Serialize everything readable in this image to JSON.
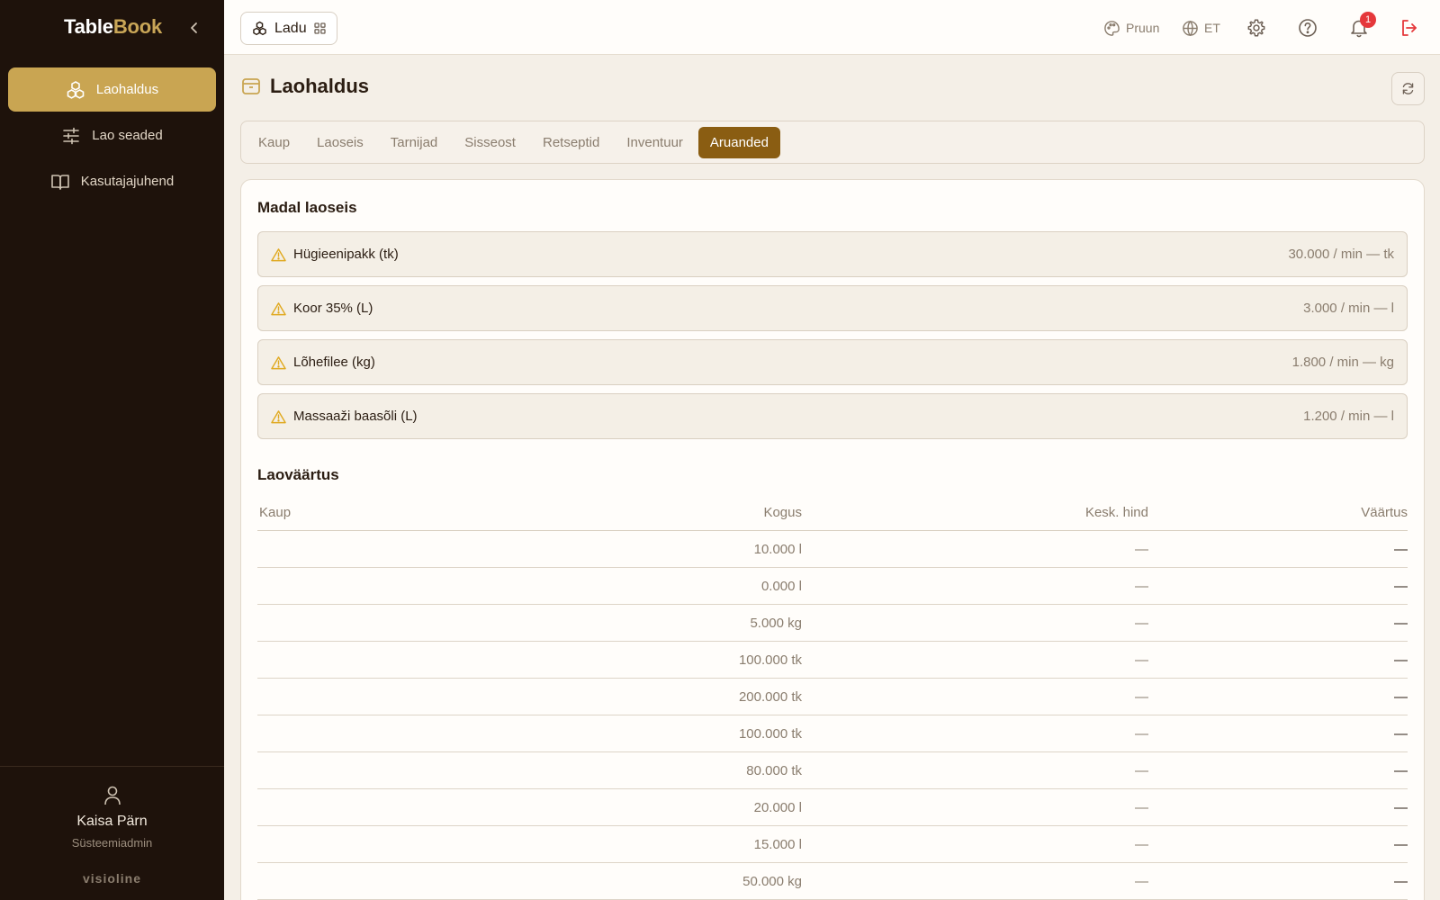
{
  "brand": {
    "part1": "Table",
    "part2": "Book"
  },
  "sidebar": {
    "items": [
      {
        "label": "Laohaldus",
        "icon": "boxes-icon",
        "active": true
      },
      {
        "label": "Lao seaded",
        "icon": "sliders-icon",
        "active": false
      },
      {
        "label": "Kasutajajuhend",
        "icon": "book-icon",
        "active": false
      }
    ],
    "user": {
      "name": "Kaisa Pärn",
      "role": "Süsteemiadmin"
    },
    "vendor": "visioline"
  },
  "topbar": {
    "module": "Ladu",
    "theme": "Pruun",
    "language": "ET",
    "notifications_count": "1"
  },
  "page": {
    "title": "Laohaldus",
    "tabs": [
      "Kaup",
      "Laoseis",
      "Tarnijad",
      "Sisseost",
      "Retseptid",
      "Inventuur",
      "Aruanded"
    ],
    "active_tab": "Aruanded"
  },
  "low_stock": {
    "title": "Madal laoseis",
    "items": [
      {
        "name": "Hügieenipakk (tk)",
        "level": "30.000 / min — tk"
      },
      {
        "name": "Koor 35% (L)",
        "level": "3.000 / min — l"
      },
      {
        "name": "Lõhefilee (kg)",
        "level": "1.800 / min — kg"
      },
      {
        "name": "Massaaži baasõli (L)",
        "level": "1.200 / min — l"
      }
    ]
  },
  "stock_value": {
    "title": "Laoväärtus",
    "columns": [
      "Kaup",
      "Kogus",
      "Kesk. hind",
      "Väärtus"
    ],
    "rows": [
      {
        "item": "",
        "qty": "10.000 l",
        "avg": "—",
        "value": "—"
      },
      {
        "item": "",
        "qty": "0.000 l",
        "avg": "—",
        "value": "—"
      },
      {
        "item": "",
        "qty": "5.000 kg",
        "avg": "—",
        "value": "—"
      },
      {
        "item": "",
        "qty": "100.000 tk",
        "avg": "—",
        "value": "—"
      },
      {
        "item": "",
        "qty": "200.000 tk",
        "avg": "—",
        "value": "—"
      },
      {
        "item": "",
        "qty": "100.000 tk",
        "avg": "—",
        "value": "—"
      },
      {
        "item": "",
        "qty": "80.000 tk",
        "avg": "—",
        "value": "—"
      },
      {
        "item": "",
        "qty": "20.000 l",
        "avg": "—",
        "value": "—"
      },
      {
        "item": "",
        "qty": "15.000 l",
        "avg": "—",
        "value": "—"
      },
      {
        "item": "",
        "qty": "50.000 kg",
        "avg": "—",
        "value": "—"
      }
    ]
  },
  "colors": {
    "sidebar_bg": "#1e120b",
    "accent_gold": "#c9a552",
    "active_tab": "#8a5d12",
    "warning": "#e0a91f",
    "danger": "#e5383b"
  }
}
